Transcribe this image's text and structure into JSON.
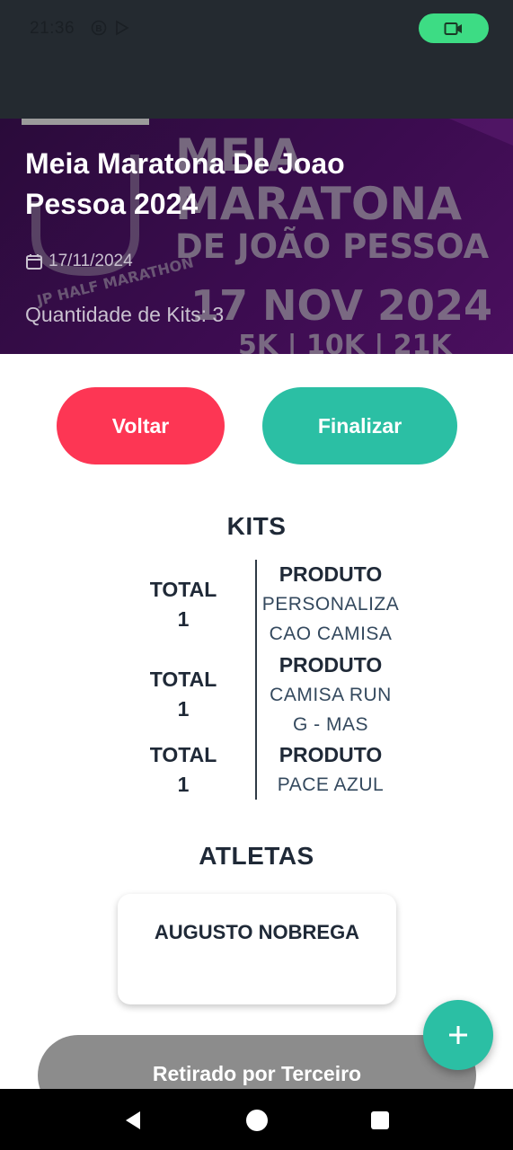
{
  "status_bar": {
    "time": "21:36",
    "icons": [
      "b-circle-icon",
      "play-store-icon"
    ],
    "record_icon": "video-camera-icon",
    "record_color": "#3ddc84"
  },
  "event": {
    "title": "Meia Maratona De Joao Pessoa 2024",
    "date": "17/11/2024",
    "kits_quantity": "Quantidade de Kits: 3",
    "banner": {
      "line1": "MEIA",
      "line2": "MARATONA",
      "line3": "DE JOÃO PESSOA",
      "date": "17 NOV 2024",
      "distances": "5K | 10K | 21K",
      "logo_text": "JP HALF MARATHON"
    }
  },
  "actions": {
    "back_label": "Voltar",
    "finish_label": "Finalizar",
    "back_color": "#fd3654",
    "finish_color": "#2bbfa4"
  },
  "kits": {
    "title": "KITS",
    "items": [
      {
        "total_label": "TOTAL",
        "total_value": "1",
        "product_label": "PRODUTO",
        "product_lines": [
          "PERSONALIZA",
          "CAO CAMISA"
        ]
      },
      {
        "total_label": "TOTAL",
        "total_value": "1",
        "product_label": "PRODUTO",
        "product_lines": [
          "CAMISA RUN",
          "G - MAS"
        ]
      },
      {
        "total_label": "TOTAL",
        "total_value": "1",
        "product_label": "PRODUTO",
        "product_lines": [
          "PACE AZUL"
        ]
      }
    ]
  },
  "athletes": {
    "title": "ATLETAS",
    "list": [
      {
        "name": "AUGUSTO NOBREGA"
      }
    ]
  },
  "fab": {
    "label": "+",
    "icon": "plus-icon"
  },
  "third_party_button": {
    "label": "Retirado por Terceiro",
    "color": "#8c8c8c"
  },
  "nav_bar": {
    "icons": [
      "back-icon",
      "home-icon",
      "recents-icon"
    ]
  }
}
